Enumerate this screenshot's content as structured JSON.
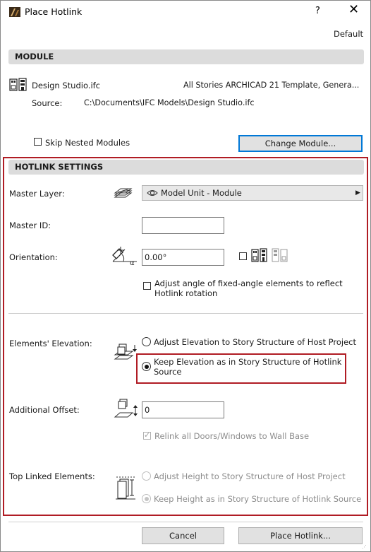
{
  "window": {
    "title": "Place Hotlink",
    "help_label": "?",
    "close_label": "✕",
    "default_label": "Default"
  },
  "module": {
    "header": "MODULE",
    "file_name": "Design Studio.ifc",
    "template": "All Stories ARCHICAD 21 Template, Genera...",
    "source_label": "Source:",
    "source_path": "C:\\Documents\\IFC Models\\Design Studio.ifc",
    "skip_nested_label": "Skip Nested Modules",
    "skip_nested_checked": false,
    "change_module_label": "Change Module..."
  },
  "hotlink": {
    "header": "HOTLINK SETTINGS",
    "master_layer_label": "Master Layer:",
    "master_layer_value": "Model Unit - Module",
    "master_id_label": "Master ID:",
    "master_id_value": "",
    "orientation_label": "Orientation:",
    "orientation_value": "0.00°",
    "adjust_angle_label_line1": "Adjust angle of fixed-angle elements to reflect",
    "adjust_angle_label_line2": "Hotlink rotation",
    "elevation_label": "Elements' Elevation:",
    "elevation_options": [
      {
        "label": "Adjust Elevation to Story Structure of Host Project",
        "selected": false
      },
      {
        "label_line1": "Keep Elevation as in Story Structure of Hotlink",
        "label_line2": "Source",
        "selected": true
      }
    ],
    "offset_label": "Additional Offset:",
    "offset_value": "0",
    "relink_label": "Relink all Doors/Windows to Wall Base",
    "relink_checked": true,
    "top_linked_label": "Top Linked Elements:",
    "top_linked_options": [
      {
        "label": "Adjust Height to Story Structure of Host Project",
        "selected": false
      },
      {
        "label": "Keep Height as in Story Structure of Hotlink Source",
        "selected": true
      }
    ]
  },
  "footer": {
    "cancel_label": "Cancel",
    "place_label": "Place Hotlink..."
  },
  "colors": {
    "highlight": "#b01c24",
    "focus_blue": "#0078d7",
    "section_bg": "#dcdcdc"
  }
}
